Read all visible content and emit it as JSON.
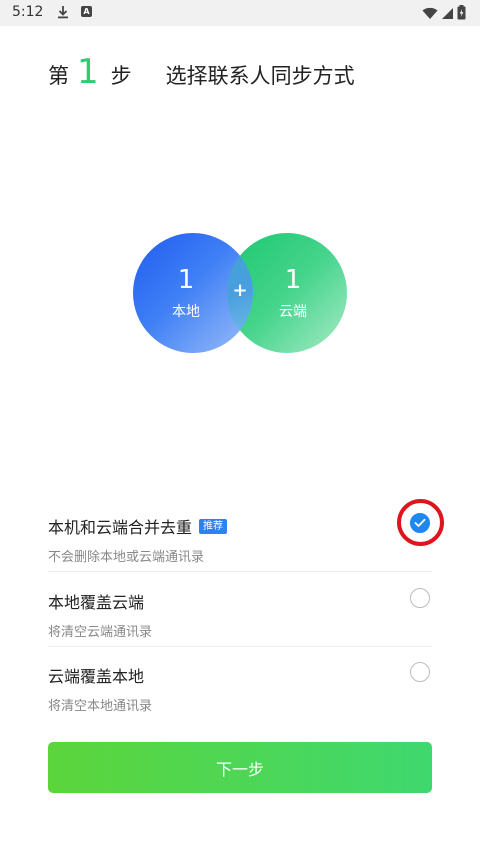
{
  "status_bar": {
    "time": "5:12",
    "icons": [
      "download-icon",
      "app-icon",
      "wifi-icon",
      "signal-icon",
      "battery-icon"
    ]
  },
  "header": {
    "prefix": "第",
    "step_number": "1",
    "suffix": "步",
    "title": "选择联系人同步方式"
  },
  "venn": {
    "local": {
      "count": "1",
      "label": "本地"
    },
    "cloud": {
      "count": "1",
      "label": "云端"
    },
    "plus": "+"
  },
  "options": [
    {
      "title": "本机和云端合并去重",
      "badge": "推荐",
      "desc": "不会删除本地或云端通讯录",
      "selected": true
    },
    {
      "title": "本地覆盖云端",
      "desc": "将清空云端通讯录",
      "selected": false
    },
    {
      "title": "云端覆盖本地",
      "desc": "将清空本地通讯录",
      "selected": false
    }
  ],
  "next_button": {
    "label": "下一步"
  },
  "colors": {
    "accent_green": "#2ecc71",
    "selected_blue": "#1e88f0",
    "highlight_red": "#e0141d"
  }
}
